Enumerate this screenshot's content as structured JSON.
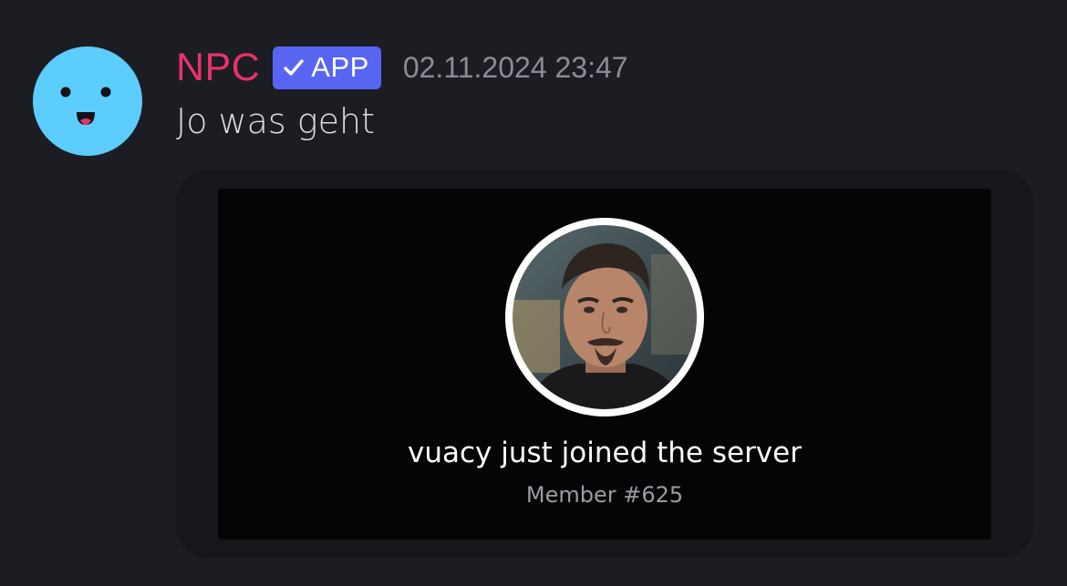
{
  "message": {
    "author": {
      "name": "NPC",
      "name_color": "#e8326b",
      "badge_label": "APP",
      "badge_icon": "checkmark-icon",
      "badge_color": "#5865f2",
      "avatar_icon": "smiley-face-icon",
      "avatar_color": "#5ccdfc"
    },
    "timestamp": "02.11.2024 23:47",
    "text": "Jo was geht"
  },
  "welcome_card": {
    "image_subject": "profile-photo",
    "title": "vuacy just joined the server",
    "subtitle": "Member #625"
  }
}
